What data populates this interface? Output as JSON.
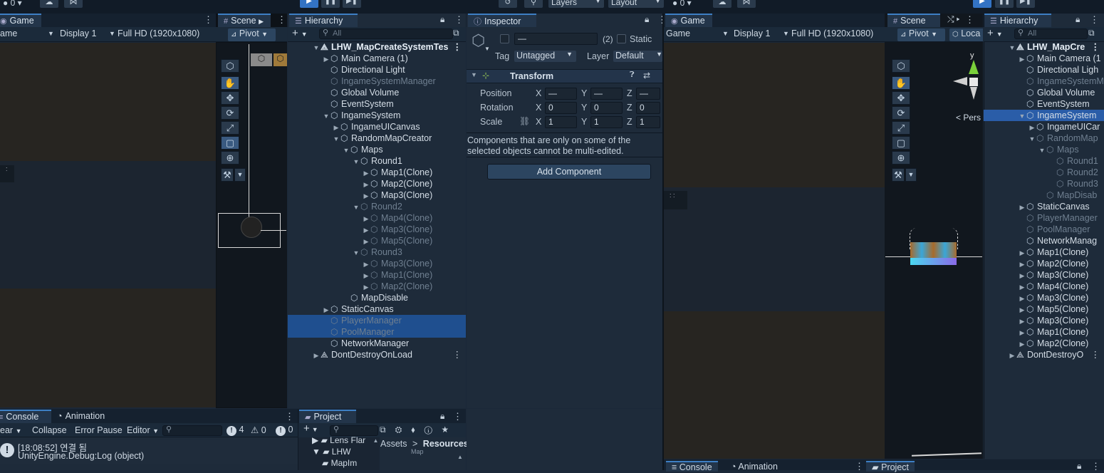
{
  "top_toolbar": {
    "left_counter": "0",
    "layers_label": "Layers",
    "layout_label": "Layout",
    "right_counter": "0"
  },
  "left_game": {
    "tab": "Game",
    "view_dropdown": "ame",
    "display": "Display 1",
    "resolution": "Full HD (1920x1080)"
  },
  "left_scene": {
    "tab": "Scene",
    "pivot": "Pivot"
  },
  "left_hierarchy": {
    "tab": "Hierarchy",
    "search_placeholder": "All",
    "rows": [
      {
        "label": "LHW_MapCreateSystemTes",
        "depth": 0,
        "tri": "▼",
        "kind": "scene"
      },
      {
        "label": "Main Camera (1)",
        "depth": 1,
        "tri": "▶",
        "kind": "normal"
      },
      {
        "label": "Directional Light",
        "depth": 1,
        "tri": "",
        "kind": "normal"
      },
      {
        "label": "IngameSystemManager",
        "depth": 1,
        "tri": "",
        "kind": "dim"
      },
      {
        "label": "Global Volume",
        "depth": 1,
        "tri": "",
        "kind": "normal"
      },
      {
        "label": "EventSystem",
        "depth": 1,
        "tri": "",
        "kind": "normal"
      },
      {
        "label": "IngameSystem",
        "depth": 1,
        "tri": "▼",
        "kind": "normal"
      },
      {
        "label": "IngameUICanvas",
        "depth": 2,
        "tri": "▶",
        "kind": "normal"
      },
      {
        "label": "RandomMapCreator",
        "depth": 2,
        "tri": "▼",
        "kind": "normal"
      },
      {
        "label": "Maps",
        "depth": 3,
        "tri": "▼",
        "kind": "normal"
      },
      {
        "label": "Round1",
        "depth": 4,
        "tri": "▼",
        "kind": "normal"
      },
      {
        "label": "Map1(Clone)",
        "depth": 5,
        "tri": "▶",
        "kind": "normal"
      },
      {
        "label": "Map2(Clone)",
        "depth": 5,
        "tri": "▶",
        "kind": "normal"
      },
      {
        "label": "Map3(Clone)",
        "depth": 5,
        "tri": "▶",
        "kind": "normal"
      },
      {
        "label": "Round2",
        "depth": 4,
        "tri": "▼",
        "kind": "dim"
      },
      {
        "label": "Map4(Clone)",
        "depth": 5,
        "tri": "▶",
        "kind": "dim"
      },
      {
        "label": "Map3(Clone)",
        "depth": 5,
        "tri": "▶",
        "kind": "dim"
      },
      {
        "label": "Map5(Clone)",
        "depth": 5,
        "tri": "▶",
        "kind": "dim"
      },
      {
        "label": "Round3",
        "depth": 4,
        "tri": "▼",
        "kind": "dim"
      },
      {
        "label": "Map3(Clone)",
        "depth": 5,
        "tri": "▶",
        "kind": "dim"
      },
      {
        "label": "Map1(Clone)",
        "depth": 5,
        "tri": "▶",
        "kind": "dim"
      },
      {
        "label": "Map2(Clone)",
        "depth": 5,
        "tri": "▶",
        "kind": "dim"
      },
      {
        "label": "MapDisable",
        "depth": 3,
        "tri": "",
        "kind": "normal"
      },
      {
        "label": "StaticCanvas",
        "depth": 1,
        "tri": "▶",
        "kind": "normal"
      },
      {
        "label": "PlayerManager",
        "depth": 1,
        "tri": "",
        "kind": "dimsel"
      },
      {
        "label": "PoolManager",
        "depth": 1,
        "tri": "",
        "kind": "dimsel"
      },
      {
        "label": "NetworkManager",
        "depth": 1,
        "tri": "",
        "kind": "normal"
      },
      {
        "label": "DontDestroyOnLoad",
        "depth": 0,
        "tri": "▶",
        "kind": "scene2"
      }
    ]
  },
  "inspector": {
    "tab": "Inspector",
    "name_value": "—",
    "multi_count": "(2)",
    "static_label": "Static",
    "tag_label": "Tag",
    "tag_value": "Untagged",
    "layer_label": "Layer",
    "layer_value": "Default",
    "transform_title": "Transform",
    "position_label": "Position",
    "rotation_label": "Rotation",
    "scale_label": "Scale",
    "x": "X",
    "y": "Y",
    "z": "Z",
    "position": [
      "—",
      "—",
      "—"
    ],
    "rotation": [
      "0",
      "0",
      "0"
    ],
    "scale": [
      "1",
      "1",
      "1"
    ],
    "notice": "Components that are only on some of the selected objects cannot be multi-edited.",
    "add_component": "Add Component"
  },
  "console": {
    "tab": "Console",
    "animation_tab": "Animation",
    "clear": "ear",
    "collapse": "Collapse",
    "error_pause": "Error Pause",
    "editor": "Editor",
    "info_count": "4",
    "warn_count": "0",
    "error_count": "0",
    "log_line1": "[18:08:52] 연결 됨",
    "log_line2": "UnityEngine.Debug:Log (object)"
  },
  "project": {
    "tab": "Project",
    "tree": [
      "Lens Flar",
      "LHW",
      "MapIm"
    ],
    "crumb_assets": "Assets",
    "crumb_resources": "Resources",
    "partial": "Map"
  },
  "right_game": {
    "tab": "Game",
    "view_dropdown": "Game",
    "display": "Display 1",
    "resolution": "Full HD (1920x1080)"
  },
  "right_scene": {
    "tab": "Scene",
    "pivot": "Pivot",
    "local": "Loca",
    "gizmo_y": "y",
    "persp": "Pers"
  },
  "right_hierarchy": {
    "tab": "Hierarchy",
    "search_placeholder": "All",
    "rows": [
      {
        "label": "LHW_MapCre",
        "depth": 0,
        "tri": "▼",
        "kind": "scene"
      },
      {
        "label": "Main Camera (1",
        "depth": 1,
        "tri": "▶",
        "kind": "normal"
      },
      {
        "label": "Directional Ligh",
        "depth": 1,
        "tri": "",
        "kind": "normal"
      },
      {
        "label": "IngameSystemM",
        "depth": 1,
        "tri": "",
        "kind": "dim"
      },
      {
        "label": "Global Volume",
        "depth": 1,
        "tri": "",
        "kind": "normal"
      },
      {
        "label": "EventSystem",
        "depth": 1,
        "tri": "",
        "kind": "normal"
      },
      {
        "label": "IngameSystem",
        "depth": 1,
        "tri": "▼",
        "kind": "selhi"
      },
      {
        "label": "IngameUICar",
        "depth": 2,
        "tri": "▶",
        "kind": "normal"
      },
      {
        "label": "RandomMap",
        "depth": 2,
        "tri": "▼",
        "kind": "dim"
      },
      {
        "label": "Maps",
        "depth": 3,
        "tri": "▼",
        "kind": "dim"
      },
      {
        "label": "Round1",
        "depth": 4,
        "tri": "",
        "kind": "dim"
      },
      {
        "label": "Round2",
        "depth": 4,
        "tri": "",
        "kind": "dim"
      },
      {
        "label": "Round3",
        "depth": 4,
        "tri": "",
        "kind": "dim"
      },
      {
        "label": "MapDisab",
        "depth": 3,
        "tri": "",
        "kind": "dim"
      },
      {
        "label": "StaticCanvas",
        "depth": 1,
        "tri": "▶",
        "kind": "normal"
      },
      {
        "label": "PlayerManager",
        "depth": 1,
        "tri": "",
        "kind": "dim"
      },
      {
        "label": "PoolManager",
        "depth": 1,
        "tri": "",
        "kind": "dim"
      },
      {
        "label": "NetworkManag",
        "depth": 1,
        "tri": "",
        "kind": "normal"
      },
      {
        "label": "Map1(Clone)",
        "depth": 1,
        "tri": "▶",
        "kind": "normal"
      },
      {
        "label": "Map2(Clone)",
        "depth": 1,
        "tri": "▶",
        "kind": "normal"
      },
      {
        "label": "Map3(Clone)",
        "depth": 1,
        "tri": "▶",
        "kind": "normal"
      },
      {
        "label": "Map4(Clone)",
        "depth": 1,
        "tri": "▶",
        "kind": "normal"
      },
      {
        "label": "Map3(Clone)",
        "depth": 1,
        "tri": "▶",
        "kind": "normal"
      },
      {
        "label": "Map5(Clone)",
        "depth": 1,
        "tri": "▶",
        "kind": "normal"
      },
      {
        "label": "Map3(Clone)",
        "depth": 1,
        "tri": "▶",
        "kind": "normal"
      },
      {
        "label": "Map1(Clone)",
        "depth": 1,
        "tri": "▶",
        "kind": "normal"
      },
      {
        "label": "Map2(Clone)",
        "depth": 1,
        "tri": "▶",
        "kind": "normal"
      },
      {
        "label": "DontDestroyO",
        "depth": 0,
        "tri": "▶",
        "kind": "scene2"
      }
    ]
  },
  "right_bottom": {
    "console_tab": "Console",
    "animation_tab": "Animation",
    "project_tab": "Project"
  },
  "colors": {
    "accent": "#3d7fc4",
    "selection": "#1f4f8f",
    "background": "#1b2838"
  },
  "icons": [
    "play-icon",
    "pause-icon",
    "step-icon",
    "history-icon",
    "search-icon",
    "cloud-icon",
    "collab-icon",
    "account-icon",
    "hand-icon",
    "move-icon",
    "rotate-icon",
    "scale-icon",
    "rect-icon",
    "transform-icon",
    "custom-tool-icon",
    "cube-icon",
    "lock-icon",
    "kebab-icon"
  ]
}
